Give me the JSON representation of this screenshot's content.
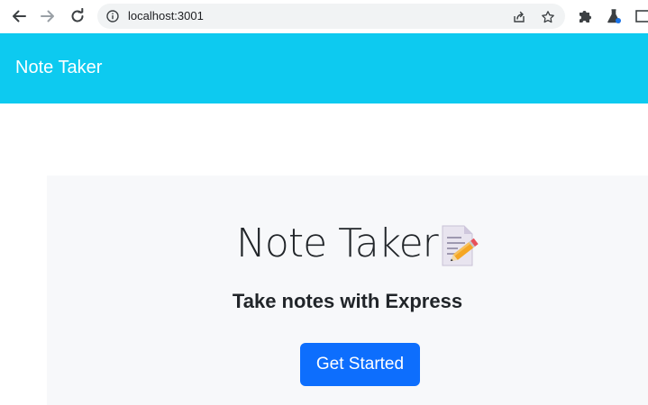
{
  "browser": {
    "url": "localhost:3001",
    "icons": [
      "back-arrow-icon",
      "forward-arrow-icon",
      "reload-icon",
      "info-icon",
      "share-icon",
      "bookmark-star-icon",
      "extensions-puzzle-icon",
      "labs-flask-icon",
      "side-panel-icon"
    ]
  },
  "navbar": {
    "brand": "Note Taker",
    "background": "#0dcaf0"
  },
  "hero": {
    "title": "Note Taker",
    "emoji_icon": "memo-icon",
    "subtitle": "Take notes with Express",
    "button_label": "Get Started",
    "button_color": "#0d6efd"
  }
}
